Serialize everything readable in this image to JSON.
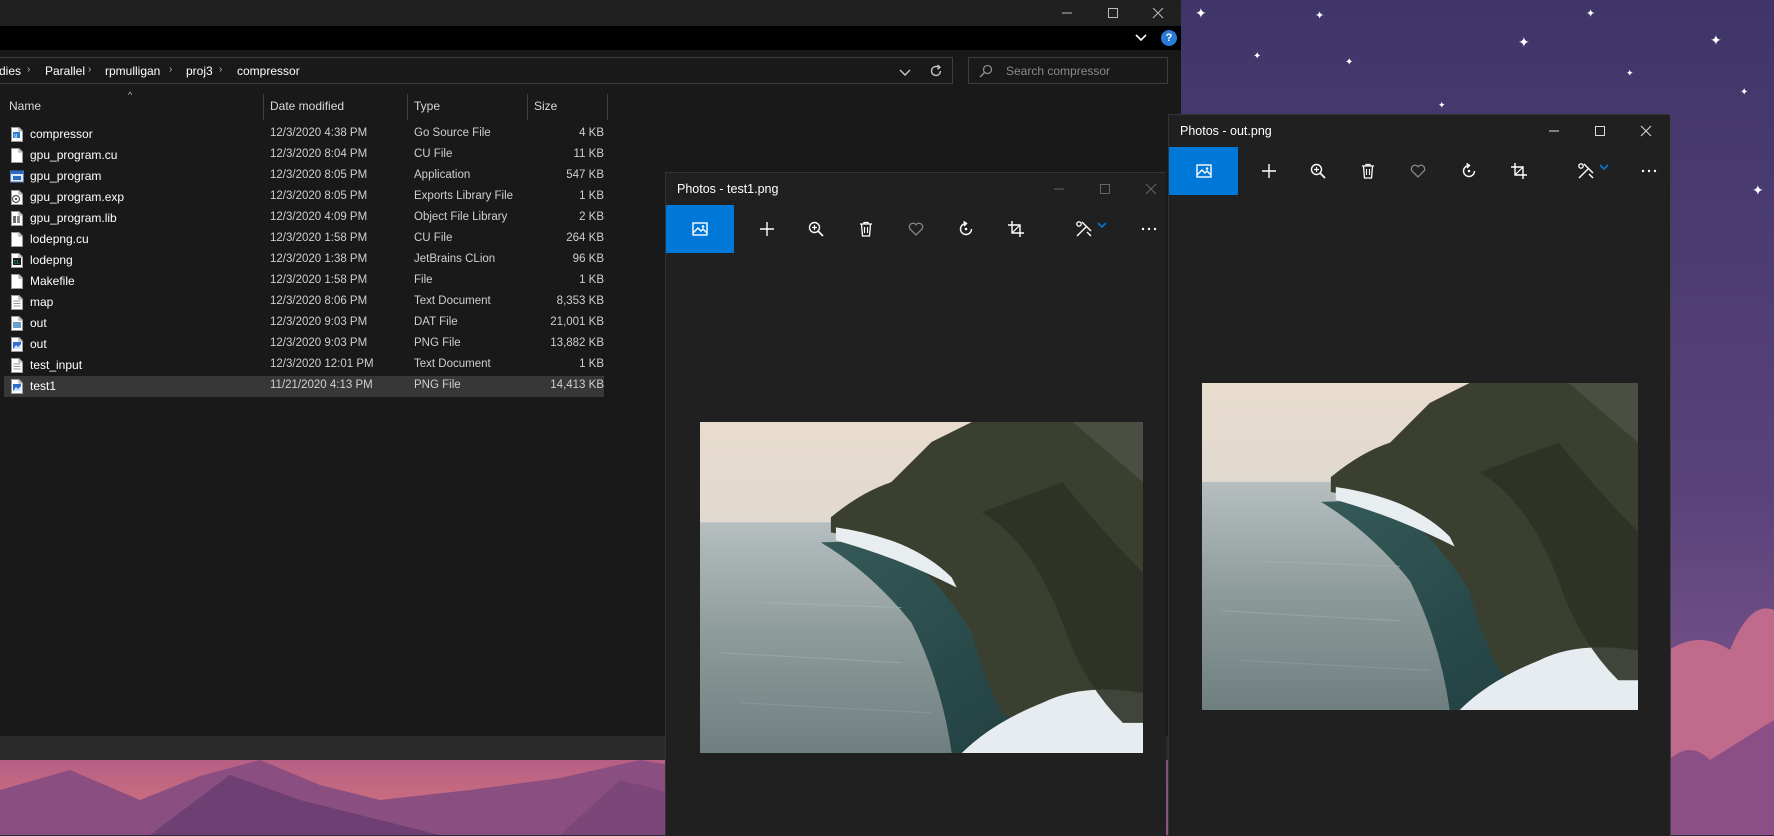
{
  "explorer": {
    "breadcrumbs": [
      "dies",
      "Parallel",
      "rpmulligan",
      "proj3",
      "compressor"
    ],
    "search_placeholder": "Search compressor",
    "help_label": "?",
    "columns": [
      "Name",
      "Date modified",
      "Type",
      "Size"
    ],
    "files": [
      {
        "name": "compressor",
        "date": "12/3/2020 4:38 PM",
        "type": "Go Source File",
        "size": "4 KB",
        "icon": "go-file-icon"
      },
      {
        "name": "gpu_program.cu",
        "date": "12/3/2020 8:04 PM",
        "type": "CU File",
        "size": "11 KB",
        "icon": "file-icon"
      },
      {
        "name": "gpu_program",
        "date": "12/3/2020 8:05 PM",
        "type": "Application",
        "size": "547 KB",
        "icon": "application-icon"
      },
      {
        "name": "gpu_program.exp",
        "date": "12/3/2020 8:05 PM",
        "type": "Exports Library File",
        "size": "1 KB",
        "icon": "exports-library-icon"
      },
      {
        "name": "gpu_program.lib",
        "date": "12/3/2020 4:09 PM",
        "type": "Object File Library",
        "size": "2 KB",
        "icon": "object-library-icon"
      },
      {
        "name": "lodepng.cu",
        "date": "12/3/2020 1:58 PM",
        "type": "CU File",
        "size": "264 KB",
        "icon": "file-icon"
      },
      {
        "name": "lodepng",
        "date": "12/3/2020 1:38 PM",
        "type": "JetBrains CLion",
        "size": "96 KB",
        "icon": "clion-file-icon"
      },
      {
        "name": "Makefile",
        "date": "12/3/2020 1:58 PM",
        "type": "File",
        "size": "1 KB",
        "icon": "file-icon"
      },
      {
        "name": "map",
        "date": "12/3/2020 8:06 PM",
        "type": "Text Document",
        "size": "8,353 KB",
        "icon": "text-file-icon"
      },
      {
        "name": "out",
        "date": "12/3/2020 9:03 PM",
        "type": "DAT File",
        "size": "21,001 KB",
        "icon": "dat-file-icon"
      },
      {
        "name": "out",
        "date": "12/3/2020 9:03 PM",
        "type": "PNG File",
        "size": "13,882 KB",
        "icon": "png-file-icon"
      },
      {
        "name": "test_input",
        "date": "12/3/2020 12:01 PM",
        "type": "Text Document",
        "size": "1 KB",
        "icon": "text-file-icon"
      },
      {
        "name": "test1",
        "date": "11/21/2020 4:13 PM",
        "type": "PNG File",
        "size": "14,413 KB",
        "icon": "png-file-icon",
        "selected": true
      }
    ]
  },
  "photos_left": {
    "title": "Photos - test1.png",
    "toolbar": [
      "see-all-photos-icon",
      "add-icon",
      "zoom-icon",
      "delete-icon",
      "favorite-icon",
      "rotate-icon",
      "crop-icon",
      "edit-icon",
      "more-icon"
    ]
  },
  "photos_right": {
    "title": "Photos - out.png",
    "toolbar": [
      "see-all-photos-icon",
      "add-icon",
      "zoom-icon",
      "delete-icon",
      "favorite-icon",
      "rotate-icon",
      "crop-icon",
      "edit-icon",
      "more-icon"
    ]
  },
  "colors": {
    "accent": "#0078d7",
    "explorer_bg": "#191919",
    "photos_bg": "#202020",
    "selected_row": "#373737"
  }
}
